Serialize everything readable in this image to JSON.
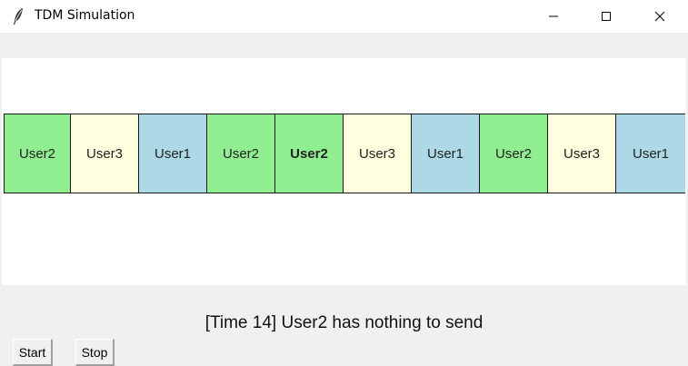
{
  "window": {
    "title": "TDM Simulation",
    "icon": "feather-icon",
    "controls": [
      "minimize-icon",
      "maximize-icon",
      "close-icon"
    ]
  },
  "slots": [
    {
      "label": "User2",
      "color": "#90ee90",
      "bold": false
    },
    {
      "label": "User3",
      "color": "#ffffe0",
      "bold": false
    },
    {
      "label": "User1",
      "color": "#add8e6",
      "bold": false
    },
    {
      "label": "User2",
      "color": "#90ee90",
      "bold": false
    },
    {
      "label": "User2",
      "color": "#90ee90",
      "bold": true
    },
    {
      "label": "User3",
      "color": "#ffffe0",
      "bold": false
    },
    {
      "label": "User1",
      "color": "#add8e6",
      "bold": false
    },
    {
      "label": "User2",
      "color": "#90ee90",
      "bold": false
    },
    {
      "label": "User3",
      "color": "#ffffe0",
      "bold": false
    },
    {
      "label": "User1",
      "color": "#add8e6",
      "bold": false
    }
  ],
  "status": "[Time 14] User2 has nothing to send",
  "buttons": {
    "start": "Start",
    "stop": "Stop"
  },
  "colors": {
    "user1": "#add8e6",
    "user2": "#90ee90",
    "user3": "#ffffe0"
  }
}
